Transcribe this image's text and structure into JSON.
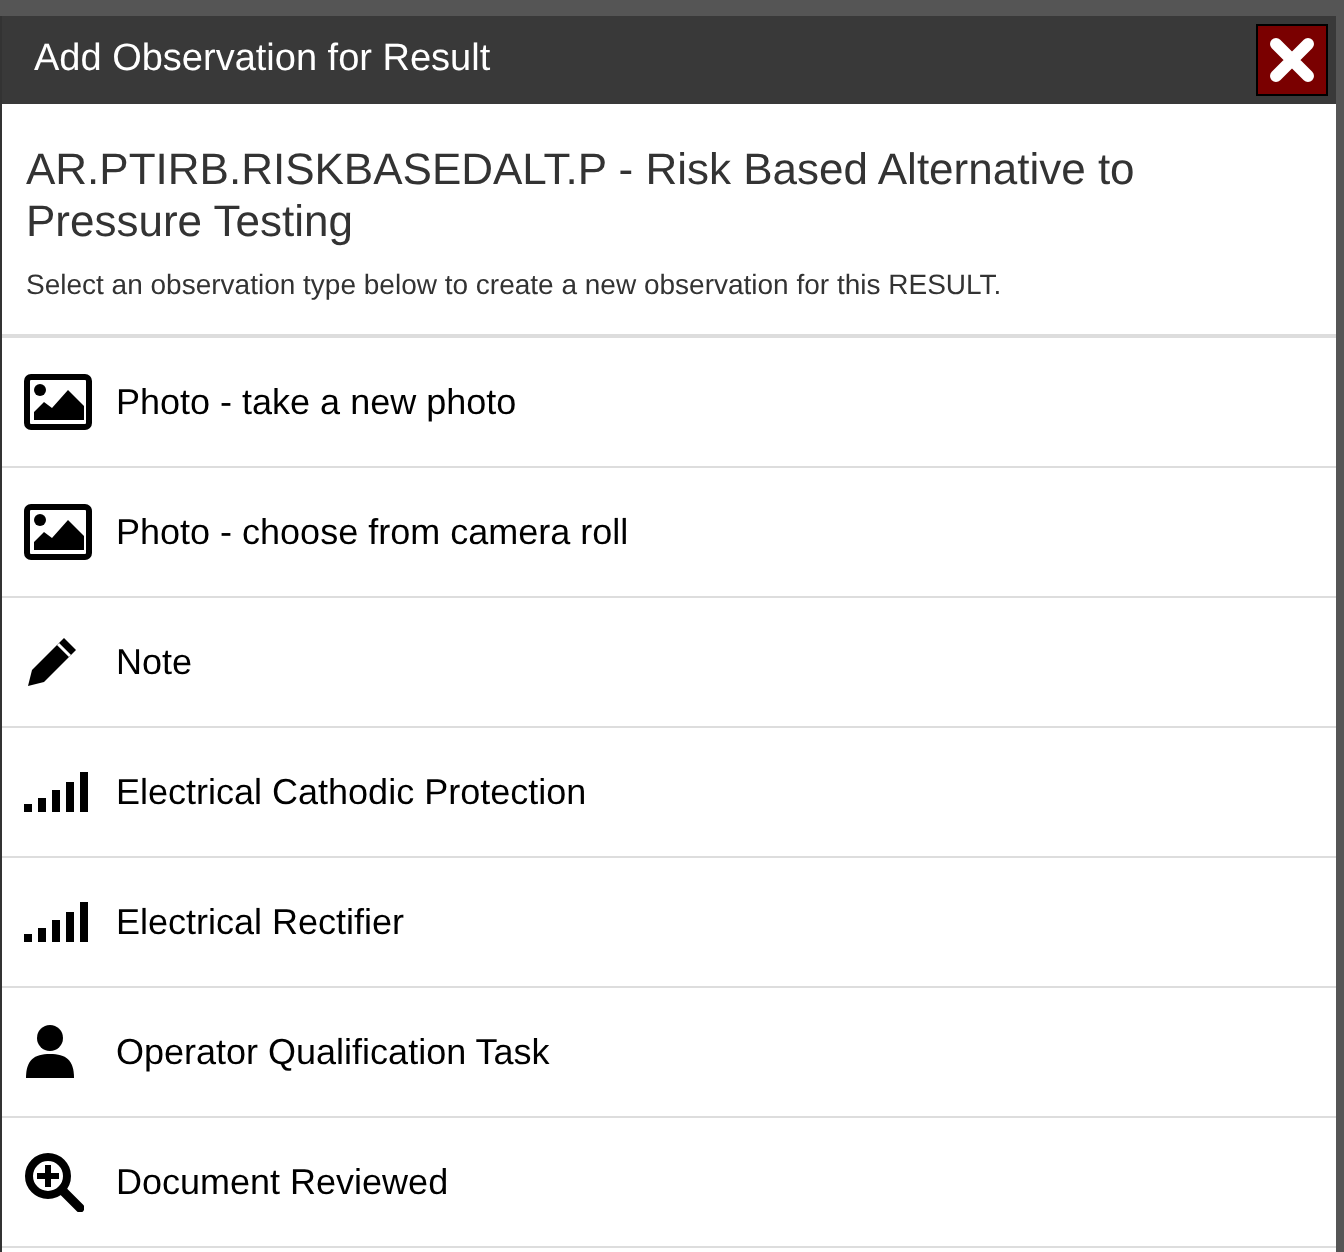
{
  "dialog": {
    "title": "Add Observation for Result",
    "heading": "AR.PTIRB.RISKBASEDALT.P - Risk Based Alternative to Pressure Testing",
    "instructions": "Select an observation type below to create a new observation for this RESULT."
  },
  "options": [
    {
      "kind": "photo",
      "label": "Photo - take a new photo"
    },
    {
      "kind": "photo",
      "label": "Photo - choose from camera roll"
    },
    {
      "kind": "note",
      "label": "Note"
    },
    {
      "kind": "signal",
      "label": "Electrical Cathodic Protection"
    },
    {
      "kind": "signal",
      "label": "Electrical Rectifier"
    },
    {
      "kind": "person",
      "label": "Operator Qualification Task"
    },
    {
      "kind": "zoom",
      "label": "Document Reviewed"
    }
  ]
}
